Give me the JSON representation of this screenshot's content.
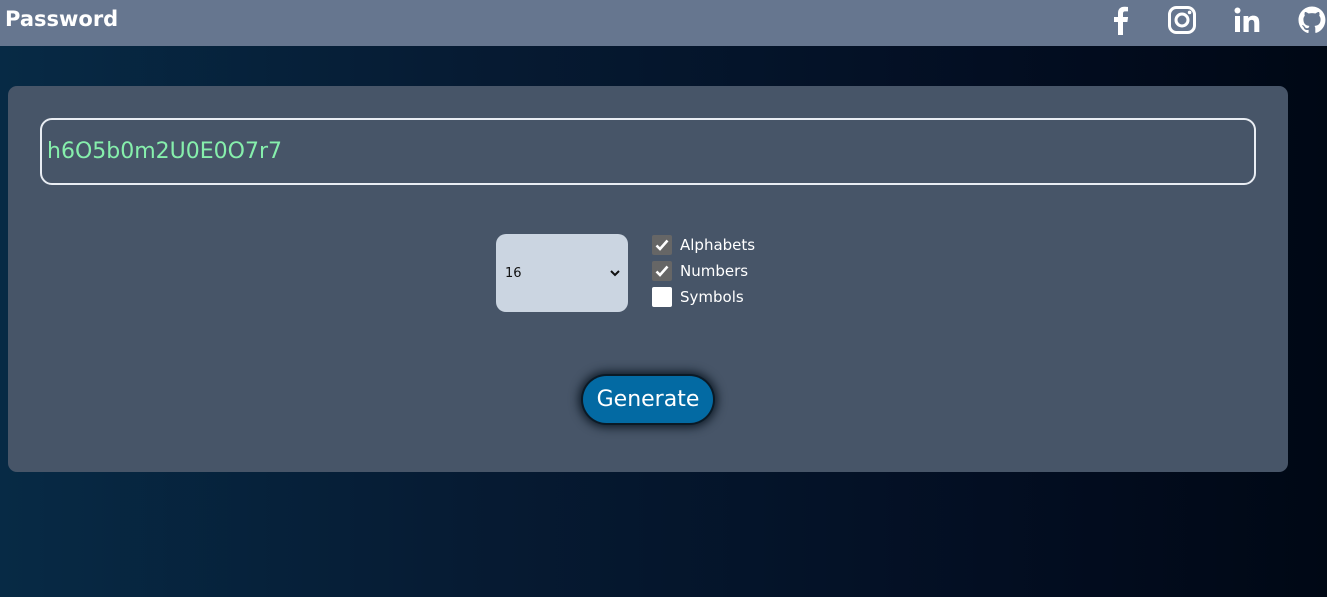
{
  "header": {
    "title": "Password",
    "social": [
      "facebook-icon",
      "instagram-icon",
      "linkedin-icon",
      "github-icon"
    ]
  },
  "generator": {
    "password_value": "h6O5b0m2U0E0O7r7",
    "length_selected": "16",
    "options": [
      {
        "label": "Alphabets",
        "checked": true
      },
      {
        "label": "Numbers",
        "checked": true
      },
      {
        "label": "Symbols",
        "checked": false
      }
    ],
    "generate_label": "Generate"
  },
  "colors": {
    "topbar": "#66768f",
    "card": "#475568",
    "password_text": "#86efac",
    "button": "#036aa3",
    "select_bg": "#cbd5e1"
  }
}
